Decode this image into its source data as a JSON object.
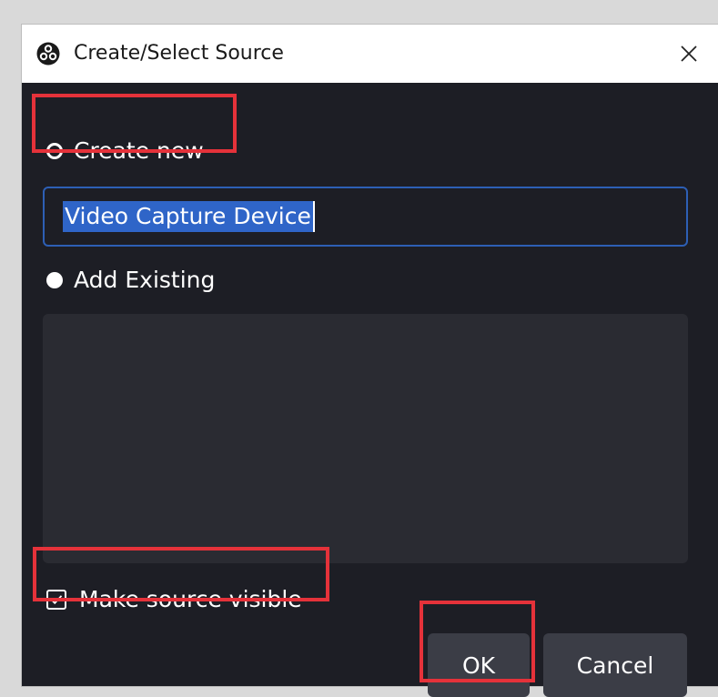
{
  "dialog": {
    "title": "Create/Select Source",
    "close_icon": "close-icon",
    "logo_icon": "obs-logo-icon"
  },
  "create_new": {
    "label": "Create new",
    "selected": false
  },
  "name_input": {
    "value": "Video Capture Device",
    "text_selected": true
  },
  "add_existing": {
    "label": "Add Existing",
    "selected": true,
    "items": []
  },
  "make_visible": {
    "label": "Make source visible",
    "checked": true
  },
  "buttons": {
    "ok_label": "OK",
    "cancel_label": "Cancel"
  },
  "colors": {
    "dialog_bg": "#1d1e25",
    "input_border": "#2d5fb5",
    "selection": "#2f65c8",
    "list_bg": "#2a2b32",
    "button_bg": "#3b3d46",
    "highlight": "#e5323a"
  }
}
